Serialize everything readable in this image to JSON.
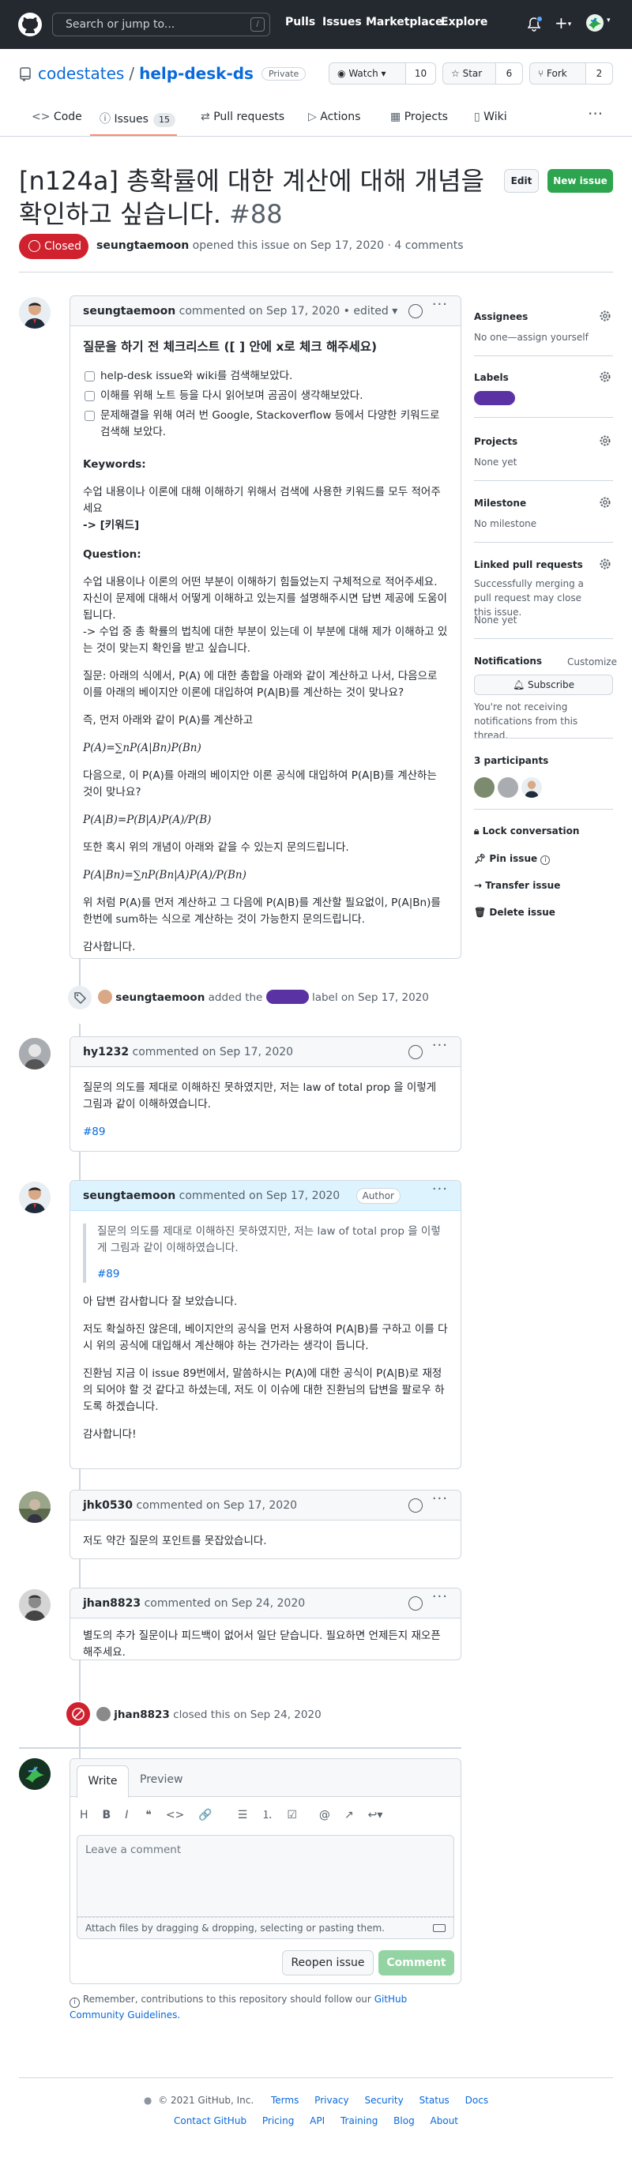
{
  "header": {
    "search_placeholder": "Search or jump to...",
    "search_key": "/",
    "nav": [
      "Pulls",
      "Issues",
      "Marketplace",
      "Explore"
    ]
  },
  "repo": {
    "owner": "codestates",
    "name": "help-desk-ds",
    "visibility": "Private",
    "watch_label": "Watch",
    "watch_count": "10",
    "star_label": "Star",
    "star_count": "6",
    "fork_label": "Fork",
    "fork_count": "2"
  },
  "tabs": [
    {
      "label": "Code"
    },
    {
      "label": "Issues",
      "count": "15"
    },
    {
      "label": "Pull requests"
    },
    {
      "label": "Actions"
    },
    {
      "label": "Projects"
    },
    {
      "label": "Wiki"
    }
  ],
  "issue": {
    "title": "[n124a] 총확률에 대한 계산에 대해 개념을 확인하고 싶습니다.",
    "number": "#88",
    "state": "Closed",
    "author": "seungtaemoon",
    "meta_text": "opened this issue on Sep 17, 2020 · 4 comments",
    "edit_label": "Edit",
    "new_issue_label": "New issue"
  },
  "comment1": {
    "author": "seungtaemoon",
    "meta": "commented on Sep 17, 2020 • edited",
    "heading": "질문을 하기 전 체크리스트 ([ ] 안에 x로 체크 해주세요)",
    "tasks": [
      "help-desk issue와 wiki를 검색해보았다.",
      "이해를 위해 노트 등을 다시 읽어보며 곰곰이 생각해보았다.",
      "문제해결을 위해 여러 번 Google, Stackoverflow 등에서 다양한 키워드로 검색해 보았다."
    ],
    "keywords_label": "Keywords:",
    "keywords_text": "수업 내용이나 이론에 대해 이해하기 위해서 검색에 사용한 키워드를 모두 적어주세요",
    "keywords_value": "-> [키워드]",
    "question_label": "Question:",
    "question_text": "수업 내용이나 이론의 어떤 부분이 이해하기 힘들었는지 구체적으로 적어주세요. 자신이 문제에 대해서 어떻게 이해하고 있는지를 설명해주시면 답변 제공에 도움이 됩니다.",
    "question_arrow": "-> 수업 중 총 확률의 법칙에 대한 부분이 있는데 이 부분에 대해 제가 이해하고 있는 것이 맞는지 확인을 받고 싶습니다.",
    "p1": "질문: 아래의 식에서, P(A) 에 대한 총합을 아래와 같이 계산하고 나서, 다음으로 이를 아래의 베이지안 이론에 대입하여 P(A|B)를 계산하는 것이 맞나요?",
    "p2": "즉, 먼저 아래와 같이 P(A)를 계산하고",
    "eq1": "P(A)=∑nP(A|Bn)P(Bn)",
    "p3": "다음으로, 이 P(A)를 아래의 베이지안 이론 공식에 대입하여 P(A|B)를 계산하는 것이 맞나요?",
    "eq2": "P(A|B)=P(B|A)P(A)/P(B)",
    "p4": "또한 혹시 위의 개념이 아래와 같을 수 있는지 문의드립니다.",
    "eq3": "P(A|Bn)=∑nP(Bn|A)P(A)/P(Bn)",
    "p5": "위 처럼 P(A)를 먼저 계산하고 그 다음에 P(A|B)를 계산할 필요없이, P(A|Bn)를 한번에 sum하는 식으로 계산하는 것이 가능한지 문의드립니다.",
    "p6": "감사합니다."
  },
  "event_label": {
    "author": "seungtaemoon",
    "before": "added the",
    "after": "label on Sep 17, 2020"
  },
  "comment2": {
    "author": "hy1232",
    "meta": "commented on Sep 17, 2020",
    "p1": "질문의 의도를 제대로 이해하진 못하였지만, 저는 law of total prop 을 이렇게 그림과 같이 이해하였습니다.",
    "link": "#89"
  },
  "comment3": {
    "author": "seungtaemoon",
    "meta": "commented on Sep 17, 2020",
    "role": "Author",
    "quote": "질문의 의도를 제대로 이해하진 못하였지만, 저는 law of total prop 을 이렇게 그림과 같이 이해하였습니다.",
    "quote_link": "#89",
    "p1": "아 답변 감사합니다 잘 보았습니다.",
    "p2": "저도 확실하진 않은데, 베이지안의 공식을 먼저 사용하여 P(A|B)를 구하고 이를 다시 위의 공식에 대입해서 계산해야 하는 건가라는 생각이 듭니다.",
    "p3": "진환님 지금 이 issue 89번에서, 말씀하시는 P(A)에 대한 공식이 P(A|B)로 재정의 되어야 할 것 같다고 하셨는데, 저도 이 이슈에 대한 진환님의 답변을 팔로우 하도록 하겠습니다.",
    "p4": "감사합니다!"
  },
  "comment4": {
    "author": "jhk0530",
    "meta": "commented on Sep 17, 2020",
    "p1": "저도 약간 질문의 포인트를 못잡았습니다."
  },
  "comment5": {
    "author": "jhan8823",
    "meta": "commented on Sep 24, 2020",
    "p1": "별도의 추가 질문이나 피드백이 없어서 일단 닫습니다. 필요하면 언제든지 재오픈 해주세요."
  },
  "event_closed": {
    "author": "jhan8823",
    "text": "closed this on Sep 24, 2020"
  },
  "editor": {
    "tab_write": "Write",
    "tab_preview": "Preview",
    "placeholder": "Leave a comment",
    "attach_text": "Attach files by dragging & dropping, selecting or pasting them.",
    "reopen_label": "Reopen issue",
    "comment_label": "Comment",
    "note_text": "Remember, contributions to this repository should follow our",
    "note_link": "GitHub Community Guidelines."
  },
  "sidebar": {
    "assignees_title": "Assignees",
    "assignees_text": "No one—assign yourself",
    "labels_title": "Labels",
    "label_color": "#5a32a3",
    "projects_title": "Projects",
    "projects_text": "None yet",
    "milestone_title": "Milestone",
    "milestone_text": "No milestone",
    "linked_title": "Linked pull requests",
    "linked_text": "Successfully merging a pull request may close this issue.",
    "linked_none": "None yet",
    "notifications_title": "Notifications",
    "customize_label": "Customize",
    "subscribe_label": "Subscribe",
    "notif_text": "You're not receiving notifications from this thread.",
    "participants_title": "3 participants",
    "lock_label": "Lock conversation",
    "pin_label": "Pin issue",
    "transfer_label": "Transfer issue",
    "delete_label": "Delete issue"
  },
  "footer": {
    "copyright": "© 2021 GitHub, Inc.",
    "row1": [
      "Terms",
      "Privacy",
      "Security",
      "Status",
      "Docs"
    ],
    "row2": [
      "Contact GitHub",
      "Pricing",
      "API",
      "Training",
      "Blog",
      "About"
    ]
  },
  "colors": {
    "header_bg": "#24292f",
    "closed_red": "#cf222e",
    "green": "#2da44e",
    "link_blue": "#0969da"
  }
}
